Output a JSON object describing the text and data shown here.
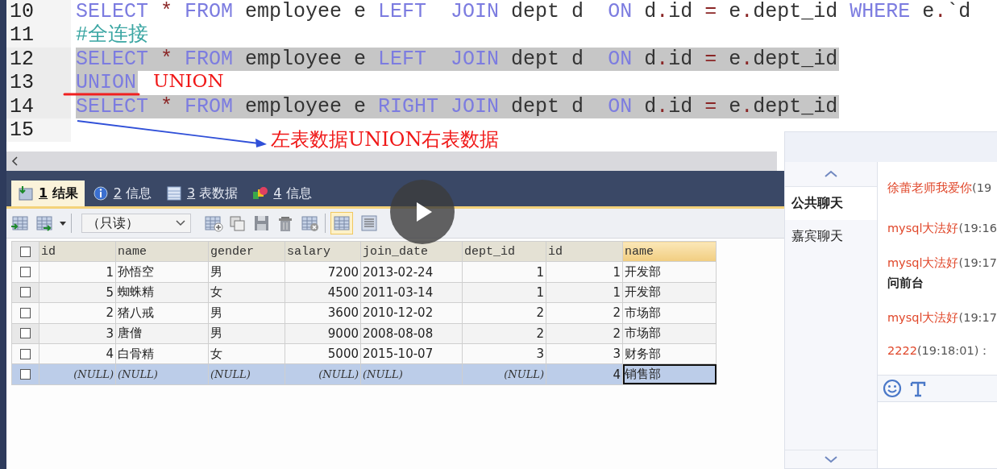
{
  "editor": {
    "lines": [
      {
        "number": "10",
        "highlighted": false,
        "tokens": [
          {
            "kind": "keyword",
            "text": "SELECT"
          },
          {
            "kind": "operator",
            "text": " * "
          },
          {
            "kind": "keyword",
            "text": "FROM"
          },
          {
            "kind": "plain",
            "text": " employee e "
          },
          {
            "kind": "keyword",
            "text": "LEFT"
          },
          {
            "kind": "keyword",
            "text": "  JOIN"
          },
          {
            "kind": "plain",
            "text": " dept d  "
          },
          {
            "kind": "keyword",
            "text": "ON"
          },
          {
            "kind": "plain",
            "text": " d"
          },
          {
            "kind": "operator",
            "text": "."
          },
          {
            "kind": "plain",
            "text": "id "
          },
          {
            "kind": "operator",
            "text": "="
          },
          {
            "kind": "plain",
            "text": " e"
          },
          {
            "kind": "operator",
            "text": "."
          },
          {
            "kind": "plain",
            "text": "dept_id "
          },
          {
            "kind": "keyword",
            "text": "WHERE"
          },
          {
            "kind": "plain",
            "text": " e"
          },
          {
            "kind": "operator",
            "text": "."
          },
          {
            "kind": "plain",
            "text": "`d"
          }
        ]
      },
      {
        "number": "11",
        "highlighted": false,
        "tokens": [
          {
            "kind": "comment",
            "text": "#全连接"
          }
        ]
      },
      {
        "number": "12",
        "highlighted": true,
        "tokens": [
          {
            "kind": "keyword",
            "text": "SELECT"
          },
          {
            "kind": "operator",
            "text": " * "
          },
          {
            "kind": "keyword",
            "text": "FROM"
          },
          {
            "kind": "plain",
            "text": " employee e "
          },
          {
            "kind": "keyword",
            "text": "LEFT"
          },
          {
            "kind": "keyword",
            "text": "  JOIN"
          },
          {
            "kind": "plain",
            "text": " dept d  "
          },
          {
            "kind": "keyword",
            "text": "ON"
          },
          {
            "kind": "plain",
            "text": " d"
          },
          {
            "kind": "operator",
            "text": "."
          },
          {
            "kind": "plain",
            "text": "id "
          },
          {
            "kind": "operator",
            "text": "="
          },
          {
            "kind": "plain",
            "text": " e"
          },
          {
            "kind": "operator",
            "text": "."
          },
          {
            "kind": "plain",
            "text": "dept_id"
          }
        ]
      },
      {
        "number": "13",
        "highlighted": true,
        "tokens": [
          {
            "kind": "keyword",
            "text": "UNION"
          }
        ]
      },
      {
        "number": "14",
        "highlighted": true,
        "tokens": [
          {
            "kind": "keyword",
            "text": "SELECT"
          },
          {
            "kind": "operator",
            "text": " * "
          },
          {
            "kind": "keyword",
            "text": "FROM"
          },
          {
            "kind": "plain",
            "text": " employee e "
          },
          {
            "kind": "keyword",
            "text": "RIGHT"
          },
          {
            "kind": "keyword",
            "text": " JOIN"
          },
          {
            "kind": "plain",
            "text": " dept d  "
          },
          {
            "kind": "keyword",
            "text": "ON"
          },
          {
            "kind": "plain",
            "text": " d"
          },
          {
            "kind": "operator",
            "text": "."
          },
          {
            "kind": "plain",
            "text": "id "
          },
          {
            "kind": "operator",
            "text": "="
          },
          {
            "kind": "plain",
            "text": " e"
          },
          {
            "kind": "operator",
            "text": "."
          },
          {
            "kind": "plain",
            "text": "dept_id"
          }
        ]
      },
      {
        "number": "15"
      }
    ]
  },
  "annotations": [
    {
      "kind": "label",
      "text": "UNION"
    },
    {
      "kind": "underline"
    },
    {
      "kind": "arrow"
    },
    {
      "kind": "label",
      "text": "左表数据UNION右表数据"
    }
  ],
  "result_tabs": [
    {
      "key": "1",
      "label": "结果",
      "kind": "result",
      "selected": true
    },
    {
      "key": "2",
      "label": "信息",
      "kind": "info",
      "selected": false
    },
    {
      "key": "3",
      "label": "表数据",
      "kind": "table",
      "selected": false
    },
    {
      "key": "4",
      "label": "信息",
      "kind": "profile",
      "selected": false
    }
  ],
  "toolbar": {
    "dropdown": {
      "value": "（只读）"
    },
    "view_toggles": [
      {
        "kind": "grid",
        "selected": true
      },
      {
        "kind": "form",
        "selected": false
      }
    ]
  },
  "grid": {
    "header_checked": false,
    "columns": [
      {
        "name": "id",
        "numeric": true,
        "selected": false
      },
      {
        "name": "name",
        "numeric": false,
        "selected": false
      },
      {
        "name": "gender",
        "numeric": false,
        "selected": false
      },
      {
        "name": "salary",
        "numeric": true,
        "selected": false
      },
      {
        "name": "join_date",
        "numeric": false,
        "selected": false
      },
      {
        "name": "dept_id",
        "numeric": true,
        "selected": false
      },
      {
        "name": "id",
        "numeric": true,
        "selected": false
      },
      {
        "name": "name",
        "numeric": false,
        "selected": true
      }
    ],
    "rows": [
      {
        "checked": false,
        "selected": false,
        "cells": [
          "1",
          "孙悟空",
          "男",
          "7200",
          "2013-02-24",
          "1",
          "1",
          "开发部"
        ]
      },
      {
        "checked": false,
        "selected": false,
        "cells": [
          "5",
          "蜘蛛精",
          "女",
          "4500",
          "2011-03-14",
          "1",
          "1",
          "开发部"
        ]
      },
      {
        "checked": false,
        "selected": false,
        "cells": [
          "2",
          "猪八戒",
          "男",
          "3600",
          "2010-12-02",
          "2",
          "2",
          "市场部"
        ]
      },
      {
        "checked": false,
        "selected": false,
        "cells": [
          "3",
          "唐僧",
          "男",
          "9000",
          "2008-08-08",
          "2",
          "2",
          "市场部"
        ]
      },
      {
        "checked": false,
        "selected": false,
        "cells": [
          "4",
          "白骨精",
          "女",
          "5000",
          "2015-10-07",
          "3",
          "3",
          "财务部"
        ]
      },
      {
        "checked": false,
        "selected": true,
        "cells": [
          {
            "text": "(NULL)",
            "null": true
          },
          {
            "text": "(NULL)",
            "null": true
          },
          {
            "text": "(NULL)",
            "null": true
          },
          {
            "text": "(NULL)",
            "null": true
          },
          {
            "text": "(NULL)",
            "null": true
          },
          {
            "text": "(NULL)",
            "null": true
          },
          "4",
          "销售部"
        ]
      }
    ]
  },
  "chat": {
    "rooms": [
      {
        "label": "公共聊天",
        "selected": true
      },
      {
        "label": "嘉宾聊天",
        "selected": false
      }
    ],
    "messages": [
      {
        "sender": "徐蕾老师我爱你",
        "time": "(19"
      },
      {
        "sender": "mysql大法好",
        "time": "(19:16"
      },
      {
        "sender": "mysql大法好",
        "time": "(19:17",
        "body": "问前台"
      },
      {
        "sender": "mysql大法好",
        "time": "(19:17"
      },
      {
        "sender": "2222",
        "time": "(19:18:01)："
      }
    ]
  }
}
